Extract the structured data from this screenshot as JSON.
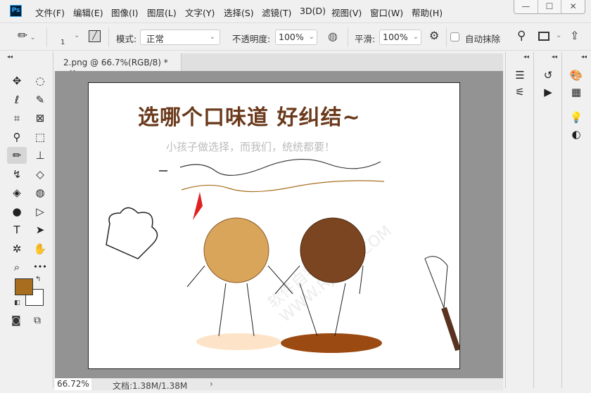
{
  "app": {
    "logo": "Ps"
  },
  "menu": [
    "文件(F)",
    "编辑(E)",
    "图像(I)",
    "图层(L)",
    "文字(Y)",
    "选择(S)",
    "滤镜(T)",
    "3D(D)",
    "视图(V)",
    "窗口(W)",
    "帮助(H)"
  ],
  "window_controls": {
    "minimize": "—",
    "maximize": "☐",
    "close": "✕"
  },
  "options": {
    "brush_size": "1",
    "mode_label": "模式:",
    "mode_value": "正常",
    "opacity_label": "不透明度:",
    "opacity_value": "100%",
    "smoothing_label": "平滑:",
    "smoothing_value": "100%",
    "auto_erase_label": "自动抹除",
    "auto_erase_checked": false
  },
  "document": {
    "tab_title": "2.png @ 66.7%(RGB/8) *",
    "close": "×"
  },
  "image": {
    "headline": "选哪个口味道 好纠结~",
    "subtitle": "小孩子做选择，而我们，统统都要！",
    "watermark": "软件自学网 WWW.RJZXW.COM"
  },
  "status": {
    "zoom": "66.72%",
    "doc_size": "文档:1.38M/1.38M",
    "arrow": "›"
  },
  "colors": {
    "foreground": "#a86d1e",
    "background": "#ffffff",
    "accent": "#31a8ff"
  },
  "tools": [
    {
      "name": "move-icon",
      "glyph": "✥"
    },
    {
      "name": "marquee-icon",
      "glyph": "◌"
    },
    {
      "name": "lasso-icon",
      "glyph": "ℓ"
    },
    {
      "name": "quick-select-icon",
      "glyph": "✎"
    },
    {
      "name": "crop-icon",
      "glyph": "⌗"
    },
    {
      "name": "frame-icon",
      "glyph": "⊠"
    },
    {
      "name": "eyedropper-icon",
      "glyph": "⚲"
    },
    {
      "name": "patch-icon",
      "glyph": "⬚"
    },
    {
      "name": "pencil-icon",
      "glyph": "✏"
    },
    {
      "name": "stamp-icon",
      "glyph": "⊥"
    },
    {
      "name": "history-brush-icon",
      "glyph": "↯"
    },
    {
      "name": "eraser-icon",
      "glyph": "◇"
    },
    {
      "name": "paint-bucket-icon",
      "glyph": "◈"
    },
    {
      "name": "blur-icon",
      "glyph": "◍"
    },
    {
      "name": "dodge-icon",
      "glyph": "●"
    },
    {
      "name": "path-select-icon",
      "glyph": "▷"
    },
    {
      "name": "type-icon",
      "glyph": "T"
    },
    {
      "name": "direct-select-icon",
      "glyph": "➤"
    },
    {
      "name": "custom-shape-icon",
      "glyph": "✲"
    },
    {
      "name": "hand-icon",
      "glyph": "✋"
    },
    {
      "name": "zoom-icon",
      "glyph": "⌕"
    },
    {
      "name": "more-tools-icon",
      "glyph": "•••"
    }
  ],
  "panels": [
    {
      "name": "brush-settings-icon",
      "glyph": "☰"
    },
    {
      "name": "brushes-icon",
      "glyph": "⚟"
    },
    {
      "name": "history-icon",
      "glyph": "↺"
    },
    {
      "name": "actions-play-icon",
      "glyph": "▶"
    },
    {
      "name": "color-palette-icon",
      "glyph": "🎨"
    },
    {
      "name": "swatches-icon",
      "glyph": "▦"
    },
    {
      "name": "learn-icon",
      "glyph": "💡"
    },
    {
      "name": "adjustments-icon",
      "glyph": "◐"
    }
  ]
}
